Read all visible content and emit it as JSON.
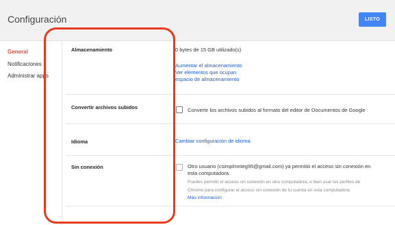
{
  "header": {
    "title": "Configuración",
    "done_label": "LISTO"
  },
  "sidebar": {
    "items": [
      {
        "label": "General"
      },
      {
        "label": "Notificaciones"
      },
      {
        "label": "Administrar apps"
      }
    ]
  },
  "settings": {
    "storage": {
      "label": "Almacenamiento",
      "usage": "0 bytes de 15 GB utilizado(s)",
      "link_increase": "Aumentar el almacenamiento",
      "link_view_line1": "Ver elementos que ocupan",
      "link_view_line2": "espacio de almacenamiento"
    },
    "convert": {
      "label": "Convertir archivos subidos",
      "checkbox_text": "Convertir los archivos subidos al formato del editor de Documentos de Google"
    },
    "language": {
      "label": "Idioma",
      "link": "Cambiar configuración de idioma"
    },
    "offline": {
      "label": "Sin conexión",
      "text_line1": "Otro usuario (csimplmnteg95@gmail.com) ya permitió el acceso sin conexión en",
      "text_line2": "esta computadora.",
      "hint_line1": "Puedes permitir el acceso sin conexión en otra computadora, o bien usar los perfiles de",
      "hint_line2": "Chrome para configurar el acceso sin conexión de tu cuenta en esta computadora.",
      "more_info": "Más información"
    }
  },
  "colors": {
    "accent": "#4285f4",
    "active_nav": "#dd4b39",
    "link": "#1a5dcf",
    "highlight": "#e63a1d"
  }
}
